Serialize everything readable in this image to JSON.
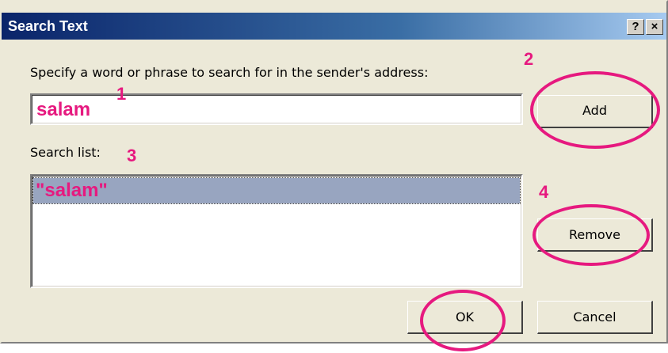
{
  "window": {
    "title": "Search Text",
    "help_label": "?",
    "close_label": "×"
  },
  "prompt_label": "Specify a word or phrase to search for in the sender's address:",
  "search_input": {
    "value": "salam"
  },
  "add_button": "Add",
  "search_list": {
    "label": "Search list:",
    "items": [
      "\"salam\""
    ]
  },
  "remove_button": "Remove",
  "ok_button": "OK",
  "cancel_button": "Cancel",
  "annotations": {
    "n1": "1",
    "n2": "2",
    "n3": "3",
    "n4": "4",
    "color": "#e6197f"
  }
}
